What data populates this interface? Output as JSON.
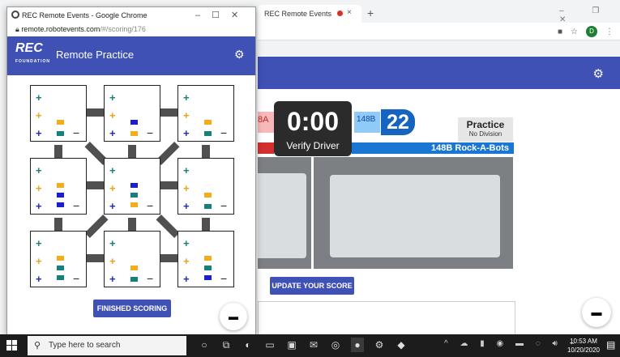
{
  "popup": {
    "title": "REC Remote Events - Google Chrome",
    "url_host": "remote.robotevents.com",
    "url_path": "/#/scoring/176",
    "logo_text": "REC",
    "logo_sub": "FOUNDATION",
    "heading": "Remote Practice",
    "finished_button": "FINISHED SCORING",
    "plus": "+",
    "minus": "−"
  },
  "bg_browser": {
    "tab_title": "REC Remote Events",
    "tab_close": "×",
    "new_tab": "+",
    "window_controls": "–  ❐  ✕",
    "avatar_letter": "D"
  },
  "scoreboard": {
    "red_team_fragment": "8A",
    "timer": "0:00",
    "timer_label": "Verify Driver",
    "blue_team": "148B",
    "blue_score": "22",
    "blue_team_name": "148B Rock-A-Bots",
    "practice_title": "Practice",
    "practice_sub": "No Division"
  },
  "update_button": "UPDATE YOUR SCORE",
  "taskbar": {
    "search_placeholder": "Type here to search",
    "time": "10:53 AM",
    "date": "10/20/2020"
  },
  "tiles": [
    {
      "bars": [
        "orange",
        "teal"
      ]
    },
    {
      "bars": [
        "blue",
        "orange"
      ]
    },
    {
      "bars": [
        "orange",
        "teal"
      ]
    },
    {
      "bars": [
        "orange",
        "blue",
        "blue"
      ]
    },
    {
      "bars": [
        "blue",
        "teal",
        "orange"
      ]
    },
    {
      "bars": [
        "orange",
        "teal"
      ]
    },
    {
      "bars": [
        "orange",
        "teal",
        "teal"
      ]
    },
    {
      "bars": [
        "orange",
        "teal"
      ]
    },
    {
      "bars": [
        "orange",
        "teal",
        "blue"
      ]
    }
  ]
}
